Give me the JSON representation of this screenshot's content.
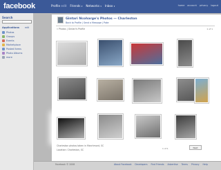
{
  "header": {
    "logo": "facebook",
    "nav": [
      {
        "label": "Profile",
        "sub": "edit"
      },
      {
        "label": "Friends",
        "sub": "▾"
      },
      {
        "label": "Networks",
        "sub": "▾"
      },
      {
        "label": "Inbox",
        "sub": "▾"
      }
    ],
    "right_links": [
      "home",
      "account",
      "privacy",
      "logout"
    ]
  },
  "sidebar": {
    "search_label": "Search",
    "apps_label": "Applications",
    "apps_edit": "edit",
    "apps": [
      {
        "label": "Photos",
        "color": "#6f93c9"
      },
      {
        "label": "Groups",
        "color": "#8bb56b"
      },
      {
        "label": "Events",
        "color": "#d46d5b"
      },
      {
        "label": "Marketplace",
        "color": "#e2b64d"
      },
      {
        "label": "Posted Items",
        "color": "#6f93c9"
      },
      {
        "label": "Photo Albums",
        "color": "#a884c6"
      },
      {
        "label": "more",
        "color": "#9aa5b8"
      }
    ]
  },
  "album": {
    "title": "Gintari Ncoharge's Photos — Charleston",
    "links": "Back to Profile  |  Send a Message  |  Poke",
    "breadcrumb": "« Photos | Gintari's Profile",
    "page_count": "1 of 1"
  },
  "photos": [
    {
      "name": "photo-1",
      "colors": [
        "#dcdcdc",
        "#aeaeae"
      ]
    },
    {
      "name": "photo-2",
      "colors": [
        "#3a4f6e",
        "#8aa8c7"
      ]
    },
    {
      "name": "photo-3",
      "colors": [
        "#c93838",
        "#4e6f9e"
      ]
    },
    {
      "name": "photo-4",
      "colors": [
        "#4a4a4a",
        "#8d8d8d"
      ]
    },
    {
      "name": "photo-5",
      "colors": [
        "#8a8a8a",
        "#4c4c4c"
      ]
    },
    {
      "name": "photo-6",
      "colors": [
        "#b8b0a2",
        "#7c756b"
      ]
    },
    {
      "name": "photo-7",
      "colors": [
        "#7b7b7b",
        "#c7c7c7"
      ]
    },
    {
      "name": "photo-8",
      "colors": [
        "#8e8e8e",
        "#575757"
      ]
    },
    {
      "name": "photo-9",
      "colors": [
        "#7caed1",
        "#d0a34e"
      ]
    },
    {
      "name": "photo-10",
      "colors": [
        "#111111",
        "#b0b0b0"
      ]
    },
    {
      "name": "photo-11",
      "colors": [
        "#8b8b8b",
        "#cfcfcf"
      ]
    },
    {
      "name": "photo-12",
      "colors": [
        "#c8c8c8",
        "#6f6f6f"
      ]
    },
    {
      "name": "photo-13",
      "colors": [
        "#3c3c3c",
        "#a7a7a7"
      ]
    }
  ],
  "album_caption": "Charleston photos taken in Marchmont, SC",
  "album_location": "Location: Charleston, SC",
  "next_label": "Next",
  "footer": {
    "copyright": "Facebook © 2008",
    "links": [
      "About Facebook",
      "Developers",
      "Find Friends",
      "Advertise",
      "Terms",
      "Privacy",
      "Help"
    ]
  }
}
